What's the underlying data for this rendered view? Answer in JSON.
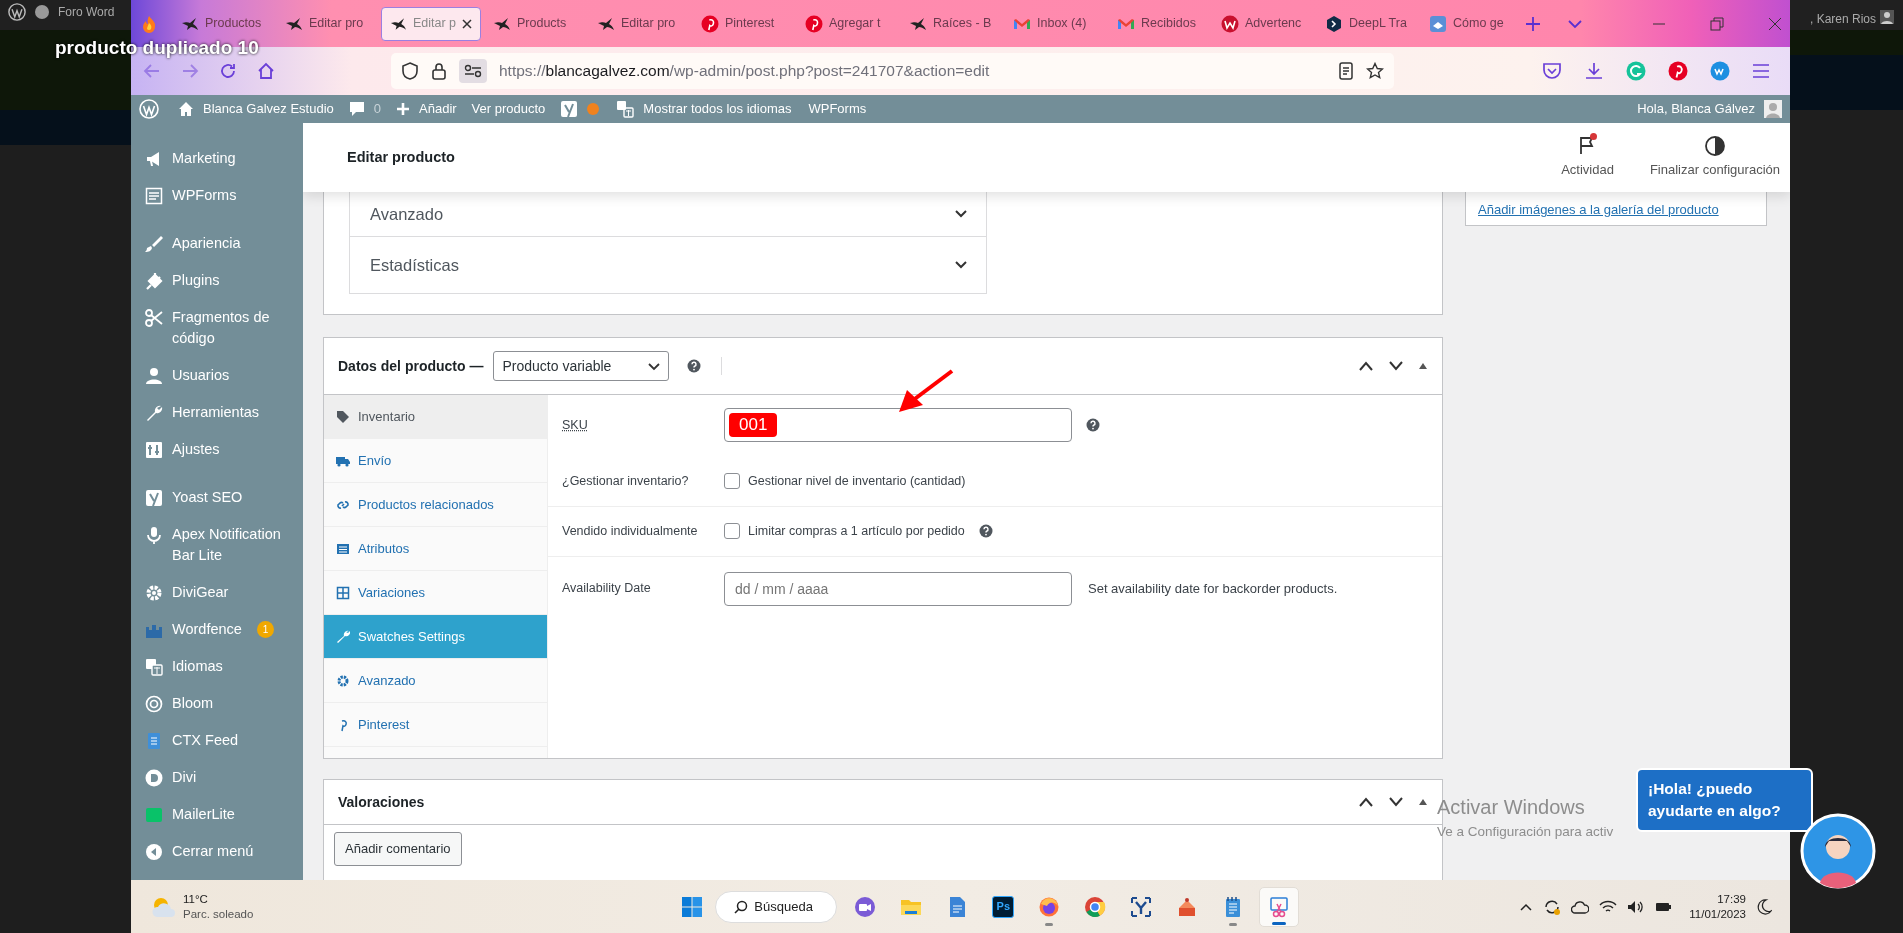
{
  "video_title": "producto duplicado 10",
  "background_window": {
    "tab_title": "Foro Word",
    "user": ", Karen Rios"
  },
  "browser": {
    "tabs": [
      {
        "label": "Productos",
        "selected": false
      },
      {
        "label": "Editar pro",
        "selected": false
      },
      {
        "label": "Editar p",
        "selected": true
      },
      {
        "label": "Products",
        "selected": false
      },
      {
        "label": "Editar pro",
        "selected": false
      },
      {
        "label": "Pinterest",
        "selected": false
      },
      {
        "label": "Agregar t",
        "selected": false
      },
      {
        "label": "Raíces - B",
        "selected": false
      },
      {
        "label": "Inbox (4)",
        "selected": false
      },
      {
        "label": "Recibidos",
        "selected": false
      },
      {
        "label": "Advertenc",
        "selected": false
      },
      {
        "label": "DeepL Tra",
        "selected": false
      },
      {
        "label": "Cómo ge",
        "selected": false
      }
    ],
    "url": {
      "scheme": "https://",
      "domain": "blancagalvez.com",
      "path": "/wp-admin/post.php?post=241707&action=edit"
    }
  },
  "admin_bar": {
    "site": "Blanca Galvez Estudio",
    "comments": "0",
    "new": "Añadir",
    "view": "Ver producto",
    "languages": "Mostrar todos los idiomas",
    "forms": "WPForms",
    "greeting": "Hola, Blanca Gálvez"
  },
  "sidebar": {
    "items": [
      {
        "label": "Marketing",
        "separated": false
      },
      {
        "label": "WPForms",
        "separated": false
      },
      {
        "label": "Apariencia",
        "separated": true
      },
      {
        "label": "Plugins",
        "separated": false
      },
      {
        "label": "Fragmentos de código",
        "separated": false
      },
      {
        "label": "Usuarios",
        "separated": false
      },
      {
        "label": "Herramientas",
        "separated": false
      },
      {
        "label": "Ajustes",
        "separated": false
      },
      {
        "label": "Yoast SEO",
        "separated": true
      },
      {
        "label": "Apex Notification Bar Lite",
        "separated": false
      },
      {
        "label": "DiviGear",
        "separated": false
      },
      {
        "label": "Wordfence",
        "separated": false,
        "badge": "1"
      },
      {
        "label": "Idiomas",
        "separated": false
      },
      {
        "label": "Bloom",
        "separated": false
      },
      {
        "label": "CTX Feed",
        "separated": false
      },
      {
        "label": "Divi",
        "separated": false
      },
      {
        "label": "MailerLite",
        "separated": false
      },
      {
        "label": "Cerrar menú",
        "separated": false
      }
    ]
  },
  "header": {
    "title": "Editar producto",
    "actions": [
      {
        "label": "Actividad",
        "notification": true
      },
      {
        "label": "Finalizar configuración",
        "notification": false
      }
    ]
  },
  "sections": [
    {
      "label": "Avanzado",
      "expanded": false
    },
    {
      "label": "Estadísticas",
      "expanded": false
    }
  ],
  "gallery_link": "Añadir imágenes a la galería del producto",
  "product_data": {
    "title": "Datos del producto —",
    "type": "Producto variable",
    "tabs": [
      {
        "label": "Inventario",
        "selected": true,
        "hovered": false
      },
      {
        "label": "Envío",
        "selected": false,
        "hovered": false
      },
      {
        "label": "Productos relacionados",
        "selected": false,
        "hovered": false
      },
      {
        "label": "Atributos",
        "selected": false,
        "hovered": false
      },
      {
        "label": "Variaciones",
        "selected": false,
        "hovered": false
      },
      {
        "label": "Swatches Settings",
        "selected": false,
        "hovered": true
      },
      {
        "label": "Avanzado",
        "selected": false,
        "hovered": false
      },
      {
        "label": "Pinterest",
        "selected": false,
        "hovered": false
      }
    ],
    "fields": [
      {
        "kind": "text",
        "label": "SKU",
        "value": "001",
        "help": true,
        "separator": false
      },
      {
        "kind": "checkbox",
        "label": "¿Gestionar inventario?",
        "text": "Gestionar nivel de inventario (cantidad)",
        "checked": false,
        "help": false,
        "separator": true
      },
      {
        "kind": "checkbox",
        "label": "Vendido individualmente",
        "text": "Limitar compras a 1 artículo por pedido",
        "checked": false,
        "help": true,
        "separator": true
      },
      {
        "kind": "date",
        "label": "Availability Date",
        "placeholder": "dd / mm / aaaa",
        "description": "Set availability date for backorder products.",
        "help": false,
        "separator": false
      }
    ]
  },
  "reviews": {
    "title": "Valoraciones",
    "button": "Añadir comentario"
  },
  "windows_activation": {
    "title": "Activar Windows",
    "text": "Ve a Configuración para activ"
  },
  "chat": {
    "message": "¡Hola! ¿puedo ayudarte en algo?"
  },
  "taskbar": {
    "weather": {
      "temperature": "11°C",
      "condition": "Parc. soleado"
    },
    "search": "Búsqueda",
    "apps": [
      {
        "running": false,
        "selected": false
      },
      {
        "running": false,
        "selected": false
      },
      {
        "running": false,
        "selected": false
      },
      {
        "glyph": "Ps",
        "running": false,
        "selected": false
      },
      {
        "running": true,
        "selected": false
      },
      {
        "running": false,
        "selected": false
      },
      {
        "running": false,
        "selected": false
      },
      {
        "running": false,
        "selected": false
      },
      {
        "running": true,
        "selected": false
      },
      {
        "running": true,
        "selected": true
      }
    ],
    "clock": {
      "time": "17:39",
      "date": "11/01/2023"
    }
  }
}
